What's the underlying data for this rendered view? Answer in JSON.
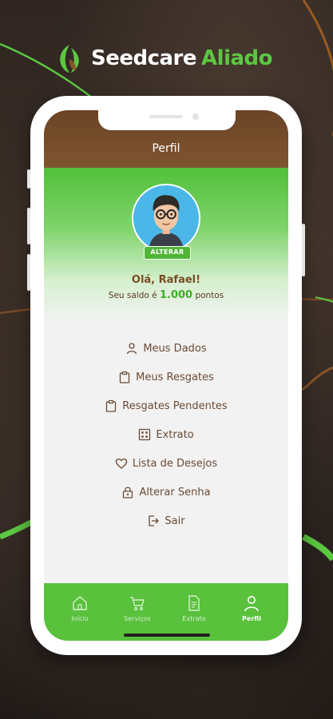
{
  "brand": {
    "name_white": "Seedcare",
    "name_green": "Aliado",
    "logo_icon": "seed-leaf-logo"
  },
  "header": {
    "title": "Perfil"
  },
  "profile": {
    "change_button": "ALTERAR",
    "greeting": "Olá, Rafael!",
    "balance_prefix": "Seu saldo é",
    "balance_value": "1.000",
    "balance_suffix": "pontos"
  },
  "menu": {
    "items": [
      {
        "label": "Meus Dados",
        "icon": "user-icon"
      },
      {
        "label": "Meus Resgates",
        "icon": "clipboard-icon"
      },
      {
        "label": "Resgates Pendentes",
        "icon": "clipboard-icon"
      },
      {
        "label": "Extrato",
        "icon": "statement-icon"
      },
      {
        "label": "Lista de Desejos",
        "icon": "heart-icon"
      },
      {
        "label": "Alterar Senha",
        "icon": "lock-icon"
      },
      {
        "label": "Sair",
        "icon": "logout-icon"
      }
    ]
  },
  "tabs": [
    {
      "label": "Início",
      "icon": "home-icon",
      "active": false
    },
    {
      "label": "Serviços",
      "icon": "cart-icon",
      "active": false
    },
    {
      "label": "Extrato",
      "icon": "document-icon",
      "active": false
    },
    {
      "label": "Perfil",
      "icon": "user-icon",
      "active": true
    }
  ],
  "colors": {
    "brand_green": "#5cc742",
    "header_brown": "#7f5530",
    "menu_text_brown": "#6b4a33",
    "tabbar_green": "#59c13c"
  }
}
